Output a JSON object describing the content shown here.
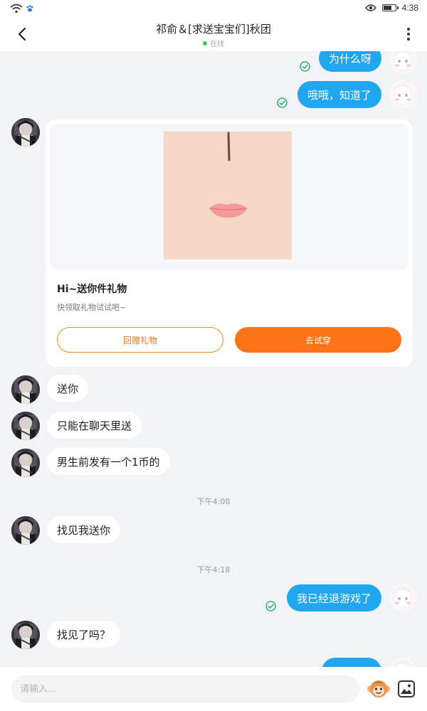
{
  "status_bar": {
    "time": "4:38",
    "icons": [
      "wifi-icon",
      "paw-icon",
      "eye-icon",
      "battery-icon"
    ],
    "battery_level": 0.7
  },
  "header": {
    "title": "祁俞＆[求送宝宝们]秋团",
    "status": "在线",
    "back_icon": "back-arrow-icon",
    "more_icon": "more-vertical-icon"
  },
  "messages": [
    {
      "side": "right",
      "text": "为什么呀",
      "status": "read"
    },
    {
      "side": "right",
      "text": "哦哦，知道了",
      "status": "read"
    },
    {
      "side": "left",
      "type": "gift-card"
    },
    {
      "side": "left",
      "text": "送你"
    },
    {
      "side": "left",
      "text": "只能在聊天里送"
    },
    {
      "side": "left",
      "text": "男生前发有一个1币的"
    },
    {
      "side": "left",
      "text": "找见我送你"
    },
    {
      "side": "right",
      "text": "我已经退游戏了",
      "status": "read"
    },
    {
      "side": "left",
      "text": "找见了吗？"
    }
  ],
  "timestamps": [
    "下午4:08",
    "下午4:18"
  ],
  "gift_card": {
    "title": "Hi~送你件礼物",
    "subtitle": "快领取礼物试试吧~",
    "return_button": "回赠礼物",
    "try_button": "去试穿"
  },
  "input": {
    "placeholder": "请输入..."
  },
  "colors": {
    "accent_blue": "#21a6f0",
    "accent_orange": "#fb7417",
    "online_green": "#34c759",
    "background": "#f1f3f7"
  }
}
